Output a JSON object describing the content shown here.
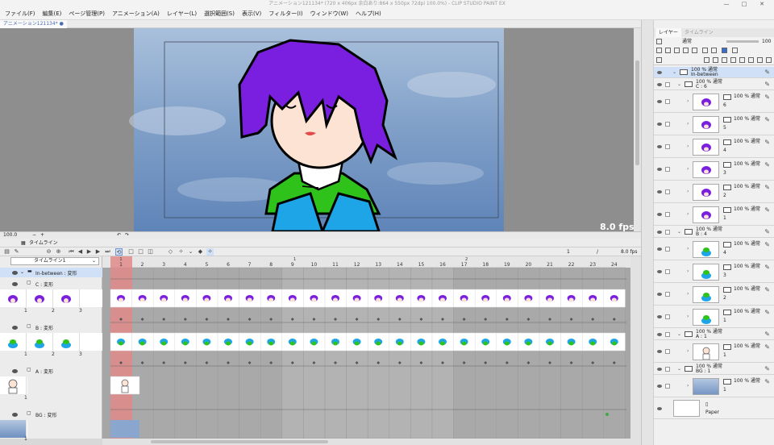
{
  "title_bar": {
    "title": "アニメーション121134* (720 x 406px 余白あり:864 x 550px 72dpi 100.0%)  - CLIP STUDIO PAINT EX"
  },
  "menu": [
    "ファイル(F)",
    "編集(E)",
    "ページ管理(P)",
    "アニメーション(A)",
    "レイヤー(L)",
    "選択範囲(S)",
    "表示(V)",
    "フィルター(I)",
    "ウィンドウ(W)",
    "ヘルプ(H)"
  ],
  "document_tab": "アニメーション121134*  ●",
  "canvas": {
    "fps_label": "8.0 fps"
  },
  "status": {
    "zoom": "100.0"
  },
  "timeline": {
    "panel_title": "タイムライン",
    "selector": "タイムライン1",
    "counter_current": "1",
    "counter_sep": "/",
    "fps_value": "8.0 fps",
    "frames": [
      "1",
      "2",
      "3",
      "4",
      "5",
      "6",
      "7",
      "8",
      "9",
      "10",
      "11",
      "12",
      "13",
      "14",
      "15",
      "16",
      "17",
      "18",
      "19",
      "20",
      "21",
      "22",
      "23",
      "24"
    ],
    "sec_mark_9": "1",
    "sec_mark_17": "2",
    "layers": {
      "inbetween": "In-between : 変形",
      "c": "C : 変形",
      "b": "B : 変形",
      "a": "A : 変形",
      "bg": "BG : 変形"
    },
    "cel_numbers": {
      "c": [
        "1",
        "2",
        "3"
      ],
      "b": [
        "1",
        "2",
        "3"
      ],
      "a": [
        "1"
      ],
      "bg": [
        "1"
      ]
    }
  },
  "right_panel": {
    "tab_layer": "レイヤー",
    "tab_other": "タイムライン",
    "blend_mode": "通常",
    "opacity": "100",
    "layers": [
      {
        "label": "100 % 通常",
        "sub": "In-between"
      },
      {
        "label": "100 % 通常",
        "sub": "C : 6"
      },
      {
        "label": "100 % 通常",
        "num": "6"
      },
      {
        "label": "100 % 通常",
        "num": "5"
      },
      {
        "label": "100 % 通常",
        "num": "4"
      },
      {
        "label": "100 % 通常",
        "num": "3"
      },
      {
        "label": "100 % 通常",
        "num": "2"
      },
      {
        "label": "100 % 通常",
        "num": "1"
      },
      {
        "label": "100 % 通常",
        "sub": "B : 4"
      },
      {
        "label": "100 % 通常",
        "num": "4"
      },
      {
        "label": "100 % 通常",
        "num": "3"
      },
      {
        "label": "100 % 通常",
        "num": "2"
      },
      {
        "label": "100 % 通常",
        "num": "1"
      },
      {
        "label": "100 % 通常",
        "sub": "A : 1"
      },
      {
        "label": "100 % 通常",
        "num": "1"
      },
      {
        "label": "100 % 通常",
        "sub": "BG : 1"
      },
      {
        "label": "100 % 通常",
        "num": "1"
      },
      {
        "label": "Paper"
      }
    ]
  },
  "colors": {
    "hair": "#7a1fe0",
    "collar": "#2fc21a",
    "jacket": "#1ea5e8",
    "sky": "#7f9fc8",
    "frame_highlight": "#e28a8a",
    "accent": "#3a6fd0"
  }
}
